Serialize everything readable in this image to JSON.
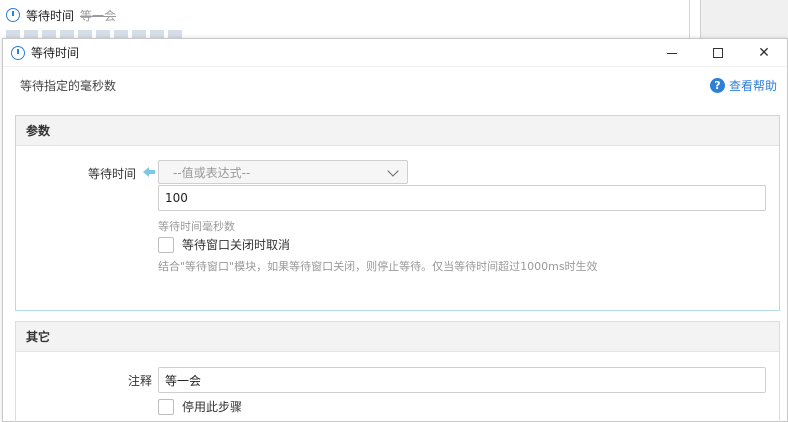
{
  "background_list": {
    "row_title": "等待时间",
    "row_comment": "等一会"
  },
  "dialog": {
    "title": "等待时间",
    "description": "等待指定的毫秒数",
    "help_label": "查看帮助",
    "help_icon": "?",
    "window_buttons": {
      "close": "✕"
    }
  },
  "params": {
    "section_title": "参数",
    "wait_time_label": "等待时间",
    "source_select": "--值或表达式--",
    "wait_time_value": "100",
    "wait_time_hint": "等待时间毫秒数",
    "cancel_on_close_label": "等待窗口关闭时取消",
    "cancel_on_close_hint": "结合\"等待窗口\"模块，如果等待窗口关闭，则停止等待。仅当等待时间超过1000ms时生效"
  },
  "other": {
    "section_title": "其它",
    "comment_label": "注释",
    "comment_value": "等一会",
    "disable_step_label": "停用此步骤"
  },
  "colors": {
    "accent": "#2f80d8",
    "panel_border": "#b8dcec",
    "arrow": "#7cc7e8"
  }
}
